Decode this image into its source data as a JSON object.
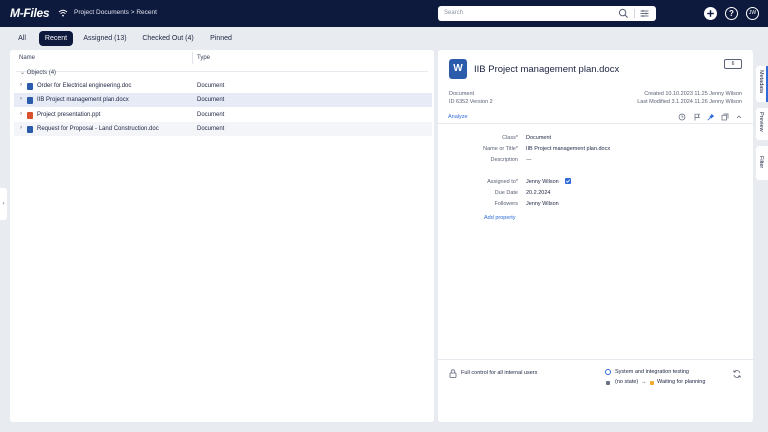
{
  "app": {
    "logo": "M-Files",
    "breadcrumb": "Project Documents > Recent"
  },
  "search": {
    "placeholder": "Search"
  },
  "header": {
    "avatar": "JW",
    "help": "?"
  },
  "tabs": [
    {
      "label": "All"
    },
    {
      "label": "Recent"
    },
    {
      "label": "Assigned (13)"
    },
    {
      "label": "Checked Out (4)"
    },
    {
      "label": "Pinned"
    }
  ],
  "list": {
    "columns": [
      "Name",
      "Type"
    ],
    "group_label": "Objects (4)",
    "rows": [
      {
        "name": "Order for Electrical engineering.doc",
        "type": "Document",
        "icon_color": "#2b5cab"
      },
      {
        "name": "IIB Project management plan.docx",
        "type": "Document",
        "icon_color": "#2b5cab"
      },
      {
        "name": "Project presentation.ppt",
        "type": "Document",
        "icon_color": "#d9512c"
      },
      {
        "name": "Request for Proposal - Land Construction.doc",
        "type": "Document",
        "icon_color": "#2b5cab"
      }
    ]
  },
  "metadata": {
    "icon_letter": "W",
    "title": "IIB Project management plan.docx",
    "comment_count": "6",
    "object_type": "Document",
    "id_version": "ID 6352 Version 2",
    "created": "Created 10.10.2023   11.25 Jenny Wilson",
    "modified": "Last Modified 3.1.2024   11.26 Jenny Wilson",
    "analyze": "Analyze",
    "properties": [
      {
        "label": "Class*",
        "value": "Document"
      },
      {
        "label": "Name or Title*",
        "value": "IIB Project management plan.docx"
      },
      {
        "label": "Description",
        "value": "---"
      },
      {
        "label": "Assigned to*",
        "value": "Jenny Wilson"
      },
      {
        "label": "Due Date",
        "value": "20.2.2024"
      },
      {
        "label": "Followers",
        "value": "Jenny Wilson"
      }
    ],
    "add_property": "Add property",
    "permissions": "Full control for all internal users",
    "workflow": "System and integration testing",
    "state_from": "(no state)",
    "arrow": "→",
    "state_to": "Waiting for planning"
  },
  "side_tabs": [
    "Metadata",
    "Preview",
    "Filter"
  ],
  "colors": {
    "brand": "#0e1a3d",
    "accent": "#2f6bd7",
    "state_to": "#f0a830",
    "state_from": "#6b7186"
  }
}
